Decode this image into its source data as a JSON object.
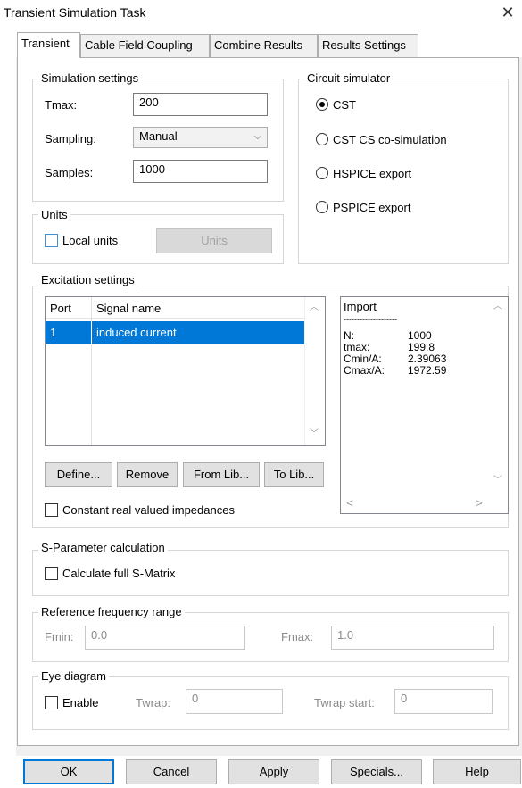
{
  "window": {
    "title": "Transient Simulation Task",
    "close_glyph": "✕"
  },
  "tabs": [
    {
      "label": "Transient",
      "active": true
    },
    {
      "label": "Cable Field Coupling",
      "active": false
    },
    {
      "label": "Combine Results",
      "active": false
    },
    {
      "label": "Results Settings",
      "active": false
    }
  ],
  "simulation_settings": {
    "legend": "Simulation settings",
    "tmax_label": "Tmax:",
    "tmax_value": "200",
    "sampling_label": "Sampling:",
    "sampling_value": "Manual",
    "sampling_chevron": "⌵",
    "samples_label": "Samples:",
    "samples_value": "1000"
  },
  "circuit_simulator": {
    "legend": "Circuit simulator",
    "options": [
      {
        "label": "CST",
        "selected": true
      },
      {
        "label": "CST CS co-simulation",
        "selected": false
      },
      {
        "label": "HSPICE export",
        "selected": false
      },
      {
        "label": "PSPICE export",
        "selected": false
      }
    ]
  },
  "units": {
    "legend": "Units",
    "local_units_label": "Local units",
    "units_button": "Units"
  },
  "excitation": {
    "legend": "Excitation settings",
    "columns": [
      "Port",
      "Signal name"
    ],
    "rows": [
      {
        "port": "1",
        "signal": "induced current"
      }
    ],
    "scroll_up": "︿",
    "scroll_down": "﹀",
    "import": {
      "title": "Import",
      "separator": "--------------------",
      "rows": [
        {
          "key": "N:",
          "value": "1000"
        },
        {
          "key": "tmax:",
          "value": "199.8"
        },
        {
          "key": "Cmin/A:",
          "value": "2.39063"
        },
        {
          "key": "Cmax/A:",
          "value": "1972.59"
        }
      ],
      "scroll_left": "<",
      "scroll_right": ">"
    },
    "buttons": {
      "define": "Define...",
      "remove": "Remove",
      "from_lib": "From Lib...",
      "to_lib": "To Lib..."
    },
    "constant_label": "Constant real valued impedances"
  },
  "s_parameter": {
    "legend": "S-Parameter calculation",
    "full_matrix_label": "Calculate full S-Matrix"
  },
  "reference_frequency": {
    "legend": "Reference frequency range",
    "fmin_label": "Fmin:",
    "fmin_value": "0.0",
    "fmax_label": "Fmax:",
    "fmax_value": "1.0"
  },
  "eye_diagram": {
    "legend": "Eye diagram",
    "enable_label": "Enable",
    "twrap_label": "Twrap:",
    "twrap_value": "0",
    "twrap_start_label": "Twrap start:",
    "twrap_start_value": "0"
  },
  "footer": {
    "ok": "OK",
    "cancel": "Cancel",
    "apply": "Apply",
    "specials": "Specials...",
    "help": "Help"
  }
}
